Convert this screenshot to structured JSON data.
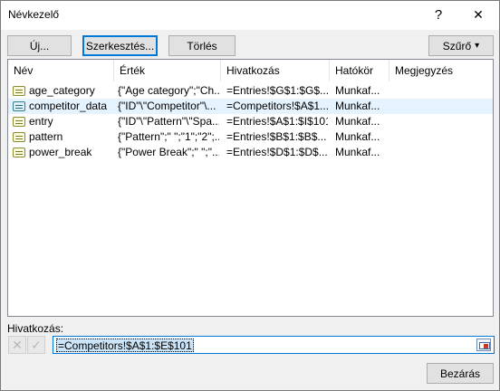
{
  "window": {
    "title": "Névkezelő",
    "help_glyph": "?",
    "close_glyph": "✕"
  },
  "toolbar": {
    "new_label": "Új...",
    "edit_label": "Szerkesztés...",
    "delete_label": "Törlés",
    "filter_label": "Szűrő",
    "filter_arrow": "▾"
  },
  "list": {
    "columns": [
      "Név",
      "Érték",
      "Hivatkozás",
      "Hatókör",
      "Megjegyzés"
    ],
    "rows": [
      {
        "name": "age_category",
        "value": "{\"Age category\";\"Ch...",
        "ref": "=Entries!$G$1:$G$...",
        "scope": "Munkaf...",
        "comment": "",
        "icon": "name-icon",
        "selected": false
      },
      {
        "name": "competitor_data",
        "value": "{\"ID\"\\\"Competitor\"\\...",
        "ref": "=Competitors!$A$1...",
        "scope": "Munkaf...",
        "comment": "",
        "icon": "table-icon",
        "selected": true
      },
      {
        "name": "entry",
        "value": "{\"ID\"\\\"Pattern\"\\\"Spa...",
        "ref": "=Entries!$A$1:$I$101",
        "scope": "Munkaf...",
        "comment": "",
        "icon": "name-icon",
        "selected": false
      },
      {
        "name": "pattern",
        "value": "{\"Pattern\";\" \";\"1\";\"2\";...",
        "ref": "=Entries!$B$1:$B$...",
        "scope": "Munkaf...",
        "comment": "",
        "icon": "name-icon",
        "selected": false
      },
      {
        "name": "power_break",
        "value": "{\"Power Break\";\" \";\"...",
        "ref": "=Entries!$D$1:$D$...",
        "scope": "Munkaf...",
        "comment": "",
        "icon": "name-icon",
        "selected": false
      }
    ]
  },
  "reference": {
    "label": "Hivatkozás:",
    "value": "=Competitors!$A$1:$E$101",
    "cancel_glyph": "✕",
    "confirm_glyph": "✓"
  },
  "footer": {
    "close_label": "Bezárás"
  }
}
